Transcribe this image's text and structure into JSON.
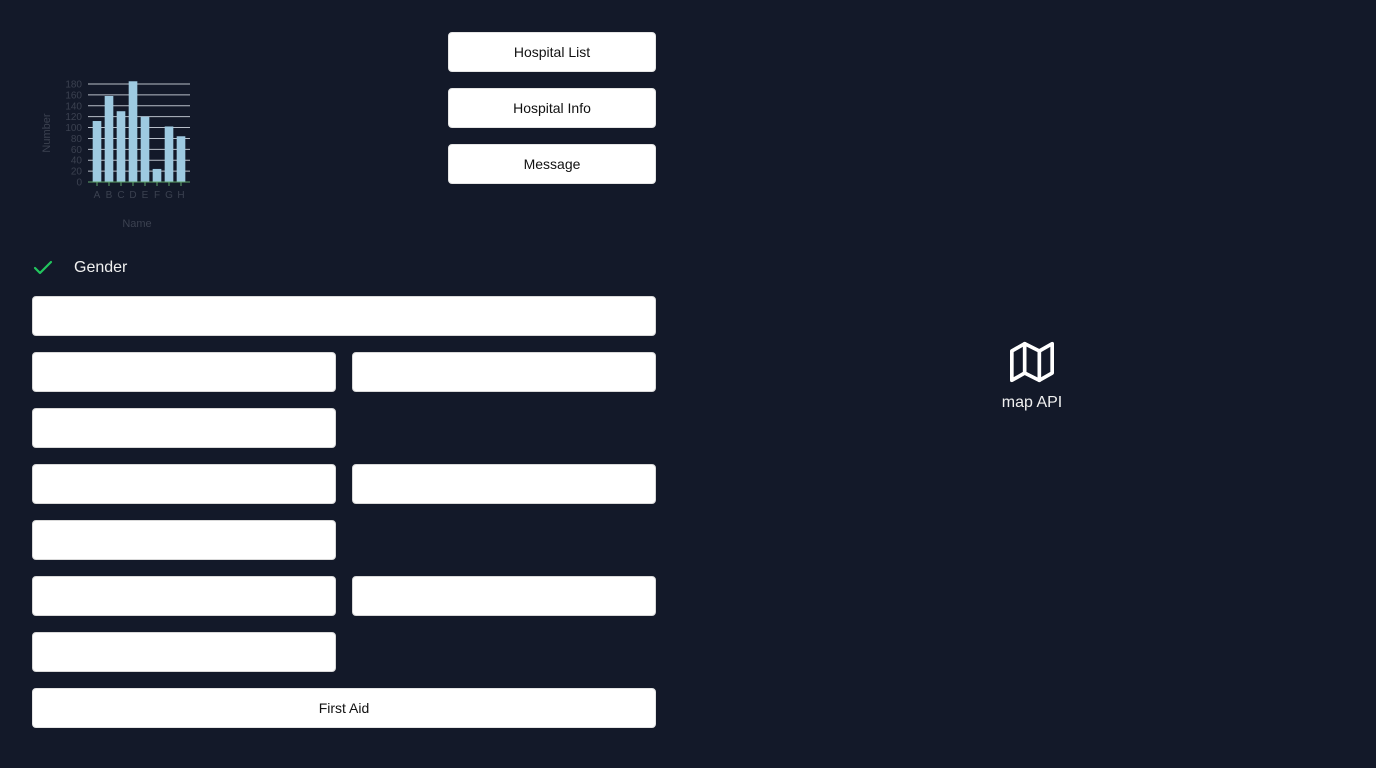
{
  "header_buttons": {
    "hospital_list": "Hospital List",
    "hospital_info": "Hospital Info",
    "message": "Message"
  },
  "gender": {
    "label": "Gender",
    "checked": true,
    "check_color": "#22c55e"
  },
  "form": {
    "fields": [
      "",
      "",
      "",
      "",
      "",
      "",
      "",
      "",
      "",
      ""
    ],
    "first_aid_label": "First Aid"
  },
  "map": {
    "label": "map API",
    "icon": "map-icon"
  },
  "chart_data": {
    "type": "bar",
    "categories": [
      "A",
      "B",
      "C",
      "D",
      "E",
      "F",
      "G",
      "H"
    ],
    "values": [
      112,
      158,
      130,
      185,
      120,
      24,
      102,
      84
    ],
    "xlabel": "Name",
    "ylabel": "Number",
    "ylim": [
      0,
      180
    ],
    "yticks": [
      0,
      20,
      40,
      60,
      80,
      100,
      120,
      140,
      160,
      180
    ],
    "bar_color": "#9ecae1",
    "grid": true
  },
  "colors": {
    "background": "#131929",
    "button_bg": "#ffffff"
  }
}
